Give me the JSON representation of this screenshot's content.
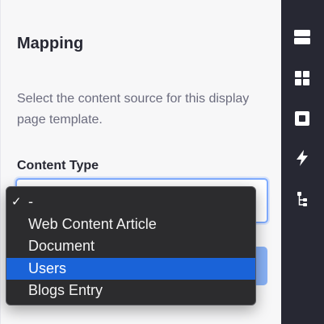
{
  "panel": {
    "title": "Mapping",
    "description": "Select the content source for this display page template.",
    "content_type_label": "Content Type"
  },
  "dropdown": {
    "options": [
      {
        "label": "-",
        "checked": true,
        "highlighted": false
      },
      {
        "label": "Web Content Article",
        "checked": false,
        "highlighted": false
      },
      {
        "label": "Document",
        "checked": false,
        "highlighted": false
      },
      {
        "label": "Users",
        "checked": false,
        "highlighted": true
      },
      {
        "label": "Blogs Entry",
        "checked": false,
        "highlighted": false
      }
    ],
    "check_glyph": "✓"
  },
  "sidebar": {
    "icons": [
      "sections-icon",
      "fragments-grid-icon",
      "widgets-icon",
      "mapping-bolt-icon",
      "page-structure-icon"
    ]
  },
  "colors": {
    "sidebar_bg": "#272833",
    "highlight": "#1a63d8",
    "focus_border": "#80acff"
  }
}
